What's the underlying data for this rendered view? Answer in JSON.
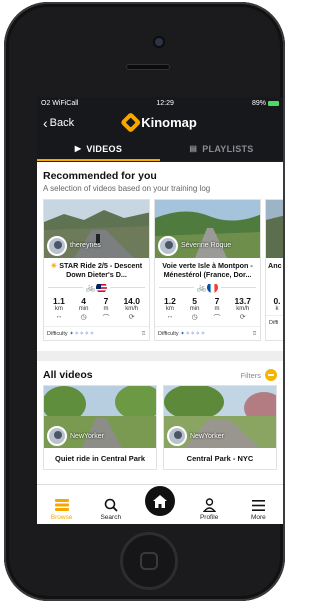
{
  "status": {
    "carrier": "O2 WiFiCall",
    "time": "12:29",
    "battery": "89%"
  },
  "nav": {
    "back_label": "Back",
    "brand": "Kinomap"
  },
  "tabs": [
    {
      "label": "VIDEOS",
      "active": true
    },
    {
      "label": "PLAYLISTS",
      "active": false
    }
  ],
  "recommended": {
    "title": "Recommended for you",
    "subtitle": "A selection of videos based on your training log",
    "cards": [
      {
        "author": "thereynes",
        "title": "STAR Ride 2/5 - Descent Down Dieter's D...",
        "flag": "us",
        "stats": [
          {
            "value": "1.1",
            "unit": "km"
          },
          {
            "value": "4",
            "unit": "min"
          },
          {
            "value": "7",
            "unit": "m"
          },
          {
            "value": "14.0",
            "unit": "km/h"
          }
        ],
        "difficulty_label": "Difficulty"
      },
      {
        "author": "Séverine Roque",
        "title": "Voie verte Isle à Montpon - Ménestérol (France, Dor...",
        "flag": "fr",
        "stats": [
          {
            "value": "1.2",
            "unit": "km"
          },
          {
            "value": "5",
            "unit": "min"
          },
          {
            "value": "7",
            "unit": "m"
          },
          {
            "value": "13.7",
            "unit": "km/h"
          }
        ],
        "difficulty_label": "Difficulty"
      },
      {
        "title": "Anc",
        "stats": [
          {
            "value": "0.",
            "unit": "k"
          }
        ],
        "difficulty_label": "Diffi"
      }
    ]
  },
  "all_videos": {
    "title": "All videos",
    "filters_label": "Filters",
    "videos": [
      {
        "author": "NewYorker",
        "title": "Quiet ride in Central Park"
      },
      {
        "author": "NewYorker",
        "title": "Central Park - NYC"
      }
    ]
  },
  "bottom_nav": [
    {
      "label": "Browse",
      "icon": "browse-icon",
      "active": true
    },
    {
      "label": "Search",
      "icon": "search-icon",
      "active": false
    },
    {
      "label": "",
      "icon": "home-icon",
      "active": false
    },
    {
      "label": "Profile",
      "icon": "profile-icon",
      "active": false
    },
    {
      "label": "More",
      "icon": "menu-icon",
      "active": false
    }
  ],
  "colors": {
    "accent": "#f7a800",
    "header_bg": "#16181c"
  }
}
